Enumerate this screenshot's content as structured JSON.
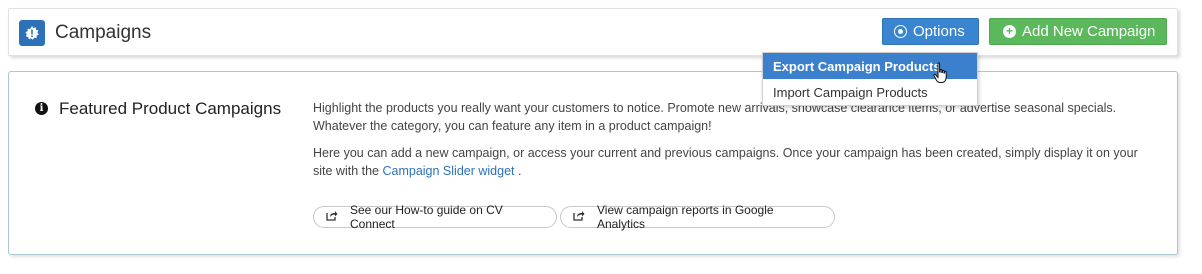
{
  "header": {
    "title": "Campaigns",
    "options_label": "Options",
    "add_label": "Add New Campaign"
  },
  "options_menu": {
    "items": [
      {
        "label": "Export Campaign Products"
      },
      {
        "label": "Import Campaign Products"
      }
    ]
  },
  "panel": {
    "title": "Featured Product Campaigns",
    "paragraph1": "Highlight the products you really want your customers to notice. Promote new arrivals, showcase clearance items, or advertise seasonal specials. Whatever the category, you can feature any item in a product campaign!",
    "paragraph2_pre": "Here you can add a new campaign, or access your current and previous campaigns. Once your campaign has been created, simply display it on your site with the ",
    "paragraph2_link": "Campaign Slider widget",
    "paragraph2_post": " .",
    "guide_button": "See our How-to guide on CV Connect",
    "reports_button": "View campaign reports in Google Analytics"
  },
  "colors": {
    "primary": "#3a85cf",
    "success": "#5cb85c",
    "menu_highlight": "#3a80cc"
  }
}
